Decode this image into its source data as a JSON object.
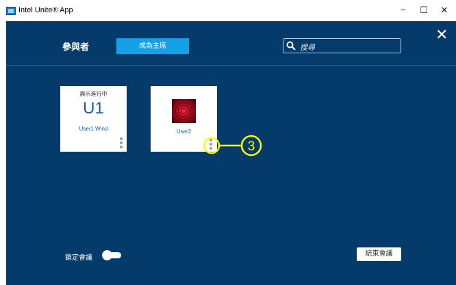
{
  "window": {
    "title": "Intel Unite® App",
    "minimize": "−",
    "maximize": "☐",
    "close": "✕"
  },
  "header": {
    "participants_label": "參與者",
    "host_button": "成為主席",
    "search_placeholder": "搜尋",
    "close": "✕"
  },
  "participants": [
    {
      "status": "展示進行中",
      "initials": "U1",
      "name": "User1 Wind"
    },
    {
      "status": "",
      "initials": "",
      "name": "User2"
    }
  ],
  "annotation": {
    "number": "3",
    "color": "#ffff00"
  },
  "footer": {
    "lock_label": "鎖定會議",
    "lock_on": true,
    "end_button": "結束會議"
  },
  "colors": {
    "background": "#053b6a",
    "accent": "#16a1e7",
    "text": "#ffffff"
  }
}
